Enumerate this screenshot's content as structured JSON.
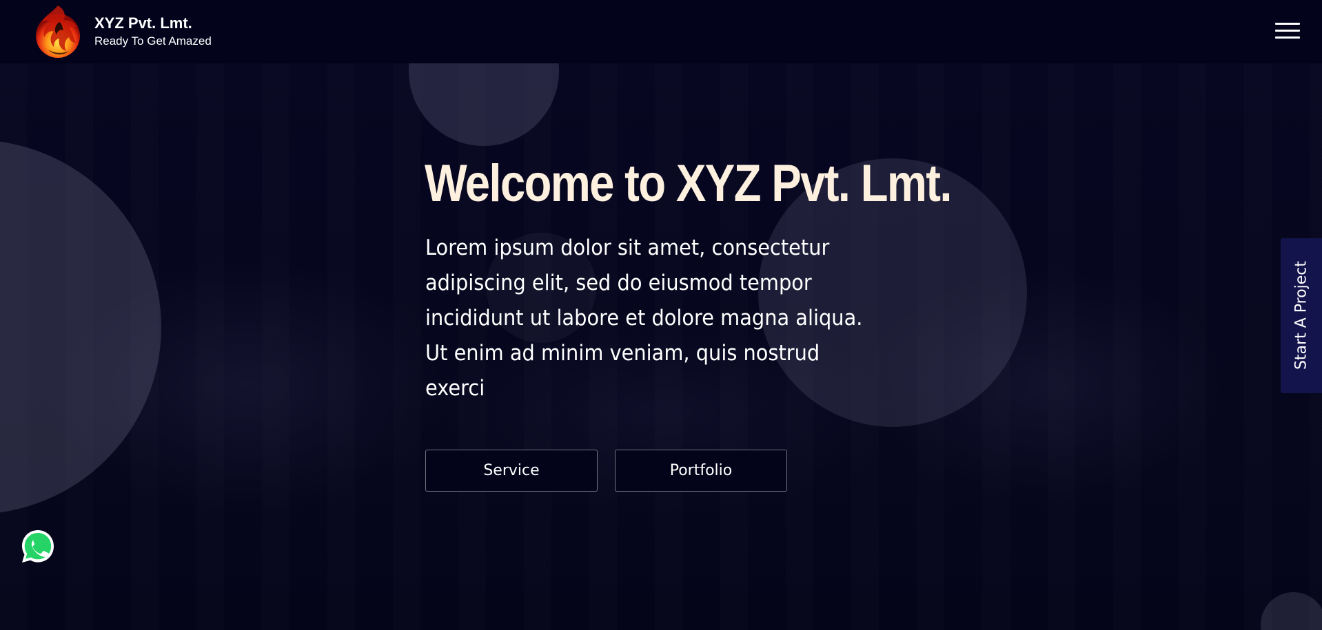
{
  "header": {
    "brand_name": "XYZ Pvt. Lmt.",
    "tagline": "Ready To Get Amazed",
    "logo_icon": "phoenix-logo",
    "menu_icon": "hamburger-menu-icon"
  },
  "hero": {
    "title": "Welcome to XYZ Pvt. Lmt.",
    "text": "Lorem ipsum dolor sit amet, consectetur adipiscing elit, sed do eiusmod tempor incididunt ut labore et dolore magna aliqua. Ut enim ad minim veniam, quis nostrud exerci",
    "buttons": {
      "service": "Service",
      "portfolio": "Portfolio"
    }
  },
  "side_tab": {
    "label": "Start A Project"
  },
  "floating": {
    "whatsapp_icon": "whatsapp-icon"
  },
  "colors": {
    "background": "#05051d",
    "header": "#03031c",
    "title": "#fdf0df",
    "side_tab": "#14144d",
    "whatsapp_green": "#25d366"
  }
}
